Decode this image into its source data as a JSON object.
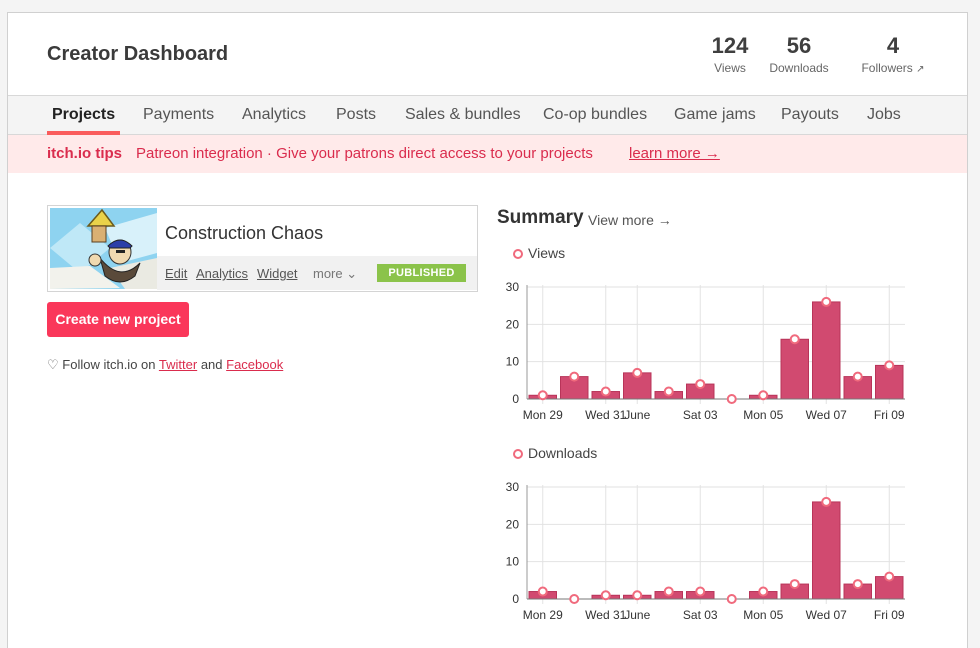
{
  "header": {
    "title": "Creator Dashboard",
    "stats": {
      "views": {
        "value": "124",
        "label": "Views"
      },
      "downloads": {
        "value": "56",
        "label": "Downloads"
      },
      "followers": {
        "value": "4",
        "label": "Followers",
        "icon": "external-arrow-icon"
      }
    }
  },
  "tabs": [
    {
      "label": "Projects",
      "active": true
    },
    {
      "label": "Payments"
    },
    {
      "label": "Analytics"
    },
    {
      "label": "Posts"
    },
    {
      "label": "Sales & bundles"
    },
    {
      "label": "Co-op bundles"
    },
    {
      "label": "Game jams"
    },
    {
      "label": "Payouts"
    },
    {
      "label": "Jobs"
    }
  ],
  "tips": {
    "label": "itch.io tips",
    "message": "Patreon integration · Give your patrons direct access to your projects",
    "link": "learn more →"
  },
  "project": {
    "title": "Construction Chaos",
    "actions": [
      "Edit",
      "Analytics",
      "Widget"
    ],
    "more": "more",
    "status": "PUBLISHED"
  },
  "create_button": "Create new project",
  "follow": {
    "prefix": "Follow itch.io on",
    "twitter": "Twitter",
    "and": "and",
    "facebook": "Facebook"
  },
  "summary": {
    "title": "Summary",
    "view_more": "View more →"
  },
  "colors": {
    "accent": "#fa5c5c",
    "button": "#fa375a",
    "bar": "#d14a70",
    "bar_stroke": "#b83459",
    "point": "#f06a7d",
    "published": "#8bc34a"
  },
  "chart_data": [
    {
      "type": "bar",
      "series": [
        {
          "name": "Views",
          "values": [
            1,
            6,
            2,
            7,
            2,
            4,
            0,
            1,
            16,
            26,
            6,
            9
          ]
        }
      ],
      "x_tick_labels": [
        "Mon 29",
        "Wed 31",
        "June",
        "Sat 03",
        "Mon 05",
        "Wed 07",
        "Fri 09"
      ],
      "y_ticks": [
        0,
        10,
        20,
        30
      ],
      "ylim": [
        0,
        30
      ],
      "grid": true,
      "legend": "top-left"
    },
    {
      "type": "bar",
      "series": [
        {
          "name": "Downloads",
          "values": [
            2,
            0,
            1,
            1,
            2,
            2,
            0,
            2,
            4,
            26,
            4,
            6
          ]
        }
      ],
      "x_tick_labels": [
        "Mon 29",
        "Wed 31",
        "June",
        "Sat 03",
        "Mon 05",
        "Wed 07",
        "Fri 09"
      ],
      "y_ticks": [
        0,
        10,
        20,
        30
      ],
      "ylim": [
        0,
        30
      ],
      "grid": true,
      "legend": "top-left"
    }
  ]
}
